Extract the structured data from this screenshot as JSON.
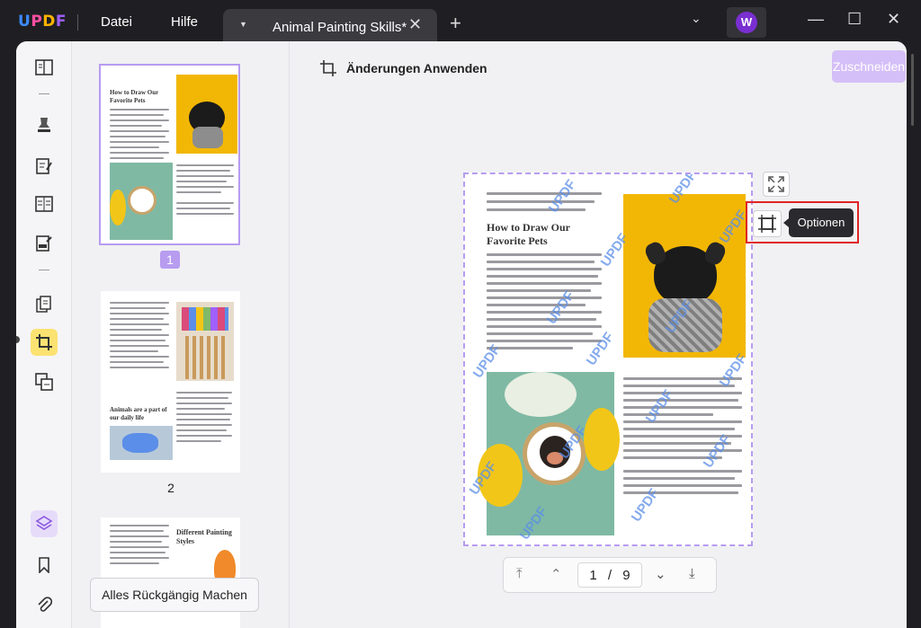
{
  "app": {
    "logo": "UPDF"
  },
  "menu": {
    "file": "Datei",
    "help": "Hilfe"
  },
  "tab": {
    "title": "Animal Painting Skills*"
  },
  "user": {
    "initial": "W"
  },
  "header": {
    "apply_label": "Änderungen Anwenden",
    "crop_button": "Zuschneiden"
  },
  "thumbnails": {
    "pages": [
      "1",
      "2"
    ]
  },
  "undo": {
    "label": "Alles Rückgängig Machen"
  },
  "tooltip": {
    "options": "Optionen"
  },
  "pager": {
    "current": "1",
    "separator": "/",
    "total": "9"
  },
  "page_content": {
    "heading_line1": "How to Draw Our",
    "heading_line2": "Favorite Pets",
    "thumb2_heading": "Animals are a part of our daily life",
    "thumb3_heading": "Different Painting Styles",
    "watermark": "UPDF"
  },
  "colors": {
    "accent": "#b79cf0",
    "highlight": "#e02424",
    "active_tool": "#fbe271"
  }
}
